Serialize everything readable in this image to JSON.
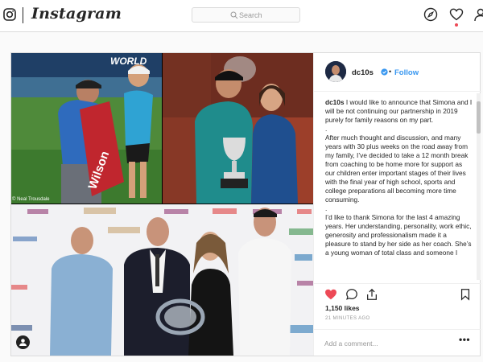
{
  "nav": {
    "brand": "Instagram",
    "search_placeholder": "Search",
    "icons": [
      "instagram-glyph-icon",
      "compass-icon",
      "heart-icon",
      "user-icon"
    ]
  },
  "post": {
    "username": "dc10s",
    "separator": "•",
    "follow_label": "Follow",
    "photo_credit": "© Neal Trousdale",
    "caption": [
      "I would like to announce that Simona and I will be not continuing our partnership in 2019 purely for family reasons on my part.",
      ".",
      "After much thought and discussion, and many years with 30 plus weeks on the road away from my family, I’ve decided to take a 12 month break from coaching to be home more for support as our children enter important stages of their lives with the final year of high school, sports and college preparations all becoming more time consuming.",
      ".",
      "I’d like to thank Simona for the last 4 amazing years. Her understanding, personality, work ethic, generosity and professionalism made it a pleasure to stand by her side as her coach. She’s a young woman of total class and someone I"
    ],
    "likes": "1,150 likes",
    "time_ago": "21 MINUTES AGO",
    "comment_placeholder": "Add a comment...",
    "more": "•••",
    "icons": [
      "heart-filled-icon",
      "comment-icon",
      "share-icon",
      "bookmark-icon"
    ]
  },
  "colors": {
    "accent": "#3897f0",
    "like_red": "#ed4956",
    "border": "#dbdbdb"
  }
}
